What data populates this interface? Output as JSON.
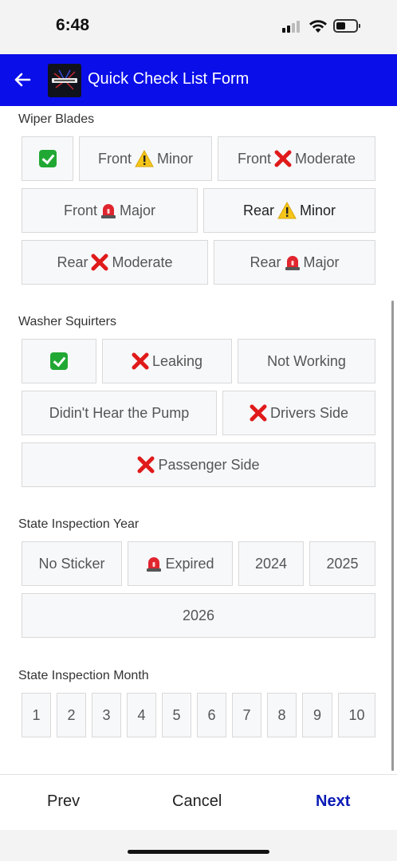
{
  "status_bar": {
    "time": "6:48"
  },
  "app_bar": {
    "title": "Quick Check List Form",
    "back_icon": "back-arrow-icon"
  },
  "sections": {
    "wiper": {
      "label": "Wiper Blades",
      "options": [
        "",
        "Front",
        "Minor",
        "Front",
        "Moderate",
        "Front",
        "Major",
        "Rear",
        "Minor",
        "Rear",
        "Moderate",
        "Rear",
        "Major"
      ]
    },
    "washer": {
      "label": "Washer Squirters",
      "options": [
        "",
        "Leaking",
        "Not Working",
        "Didin't Hear the Pump",
        "Drivers Side",
        "Passenger Side"
      ]
    },
    "state_year": {
      "label": "State Inspection Year",
      "options": [
        "No Sticker",
        "Expired",
        "2024",
        "2025",
        "2026"
      ]
    },
    "state_month": {
      "label": "State Inspection Month",
      "options": [
        "1",
        "2",
        "3",
        "4",
        "5",
        "6",
        "7",
        "8",
        "9",
        "10"
      ]
    }
  },
  "footer": {
    "prev": "Prev",
    "cancel": "Cancel",
    "next": "Next"
  },
  "colors": {
    "app_bar": "#0a0ee8",
    "next": "#0a1ab5",
    "check": "#21a834",
    "cross": "#e01a1a",
    "warning": "#f5c518",
    "siren": "#e0252e"
  }
}
